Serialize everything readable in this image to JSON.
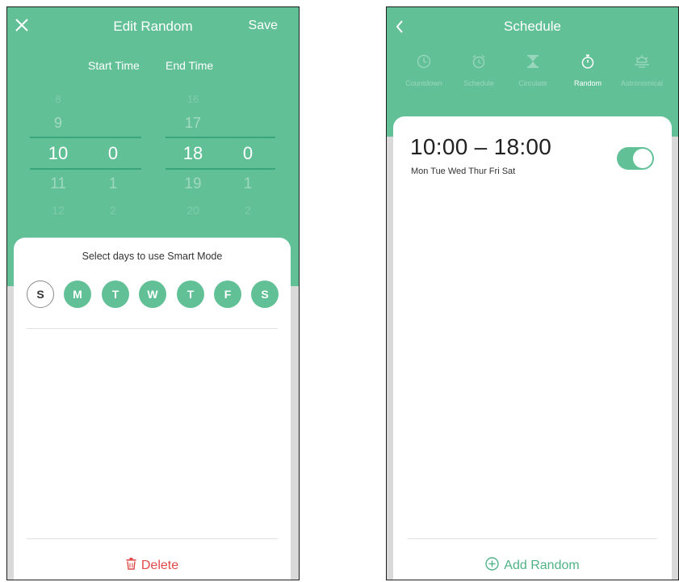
{
  "left": {
    "header": {
      "title": "Edit Random",
      "save_label": "Save"
    },
    "columns": {
      "start_label": "Start Time",
      "end_label": "End Time"
    },
    "start_hour": [
      "8",
      "9",
      "10",
      "11",
      "12"
    ],
    "start_minute": [
      "",
      "",
      "0",
      "1",
      "2"
    ],
    "end_hour": [
      "16",
      "17",
      "18",
      "19",
      "20"
    ],
    "end_minute": [
      "",
      "",
      "0",
      "1",
      "2"
    ],
    "sheet_title": "Select days to use Smart Mode",
    "days": [
      {
        "letter": "S",
        "selected": false
      },
      {
        "letter": "M",
        "selected": true
      },
      {
        "letter": "T",
        "selected": true
      },
      {
        "letter": "W",
        "selected": true
      },
      {
        "letter": "T",
        "selected": true
      },
      {
        "letter": "F",
        "selected": true
      },
      {
        "letter": "S",
        "selected": true
      }
    ],
    "delete_label": "Delete"
  },
  "right": {
    "header": {
      "title": "Schedule"
    },
    "modes": [
      {
        "label": "Countdown",
        "icon": "clock-icon",
        "active": false
      },
      {
        "label": "Schedule",
        "icon": "alarm-clock-icon",
        "active": false
      },
      {
        "label": "Circulate",
        "icon": "hourglass-icon",
        "active": false
      },
      {
        "label": "Random",
        "icon": "stopwatch-icon",
        "active": true
      },
      {
        "label": "Astronomical",
        "icon": "sun-icon",
        "active": false
      }
    ],
    "item": {
      "time_range": "10:00 – 18:00",
      "repeat": "Mon Tue Wed Thur Fri Sat",
      "enabled": true
    },
    "add_label": "Add Random"
  },
  "colors": {
    "accent": "#62c097",
    "danger": "#e24a4a"
  }
}
